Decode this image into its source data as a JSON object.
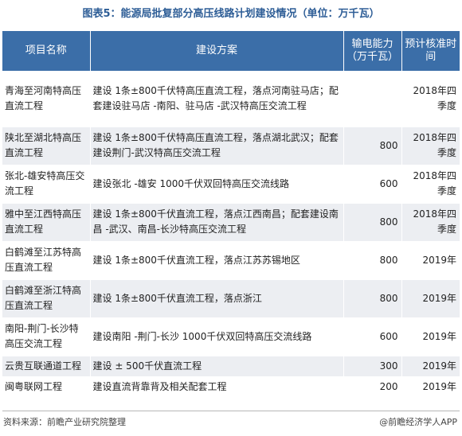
{
  "title": "图表5：能源局批复部分高压线路计划建设情况（单位：万千瓦）",
  "headers": [
    "项目名称",
    "建设方案",
    "输电能力（万千瓦）",
    "预计核准时间"
  ],
  "rows": [
    {
      "name": "青海至河南特高压直流工程",
      "plan": "建设 1条±800千伏特高压直流工程，落点河南驻马店；配套建设驻马店 -南阳、驻马店 -武汉特高压交流工程",
      "capacity": "",
      "time": "2018年四季度"
    },
    {
      "name": "陕北至湖北特高压直流工程",
      "plan": "建设 1条±800千伏特高压直流工程，落点湖北武汉；配套建设荆门-武汉特高压交流工程",
      "capacity": "800",
      "time": "2018年四季度"
    },
    {
      "name": "张北-雄安特高压交流工程",
      "plan": "建设张北 -雄安 1000千伏双回特高压交流线路",
      "capacity": "600",
      "time": "2018年四季度"
    },
    {
      "name": "雅中至江西特高压直流工程",
      "plan": "建设 1条±800千伏直流工程，落点江西南昌；配套建设南昌 -武汉、南昌-长沙特高压交流工程",
      "capacity": "800",
      "time": "2018年四季度"
    },
    {
      "name": "白鹤滩至江苏特高压直流工程",
      "plan": "建设 1条±800千伏直流工程，落点江苏苏锡地区",
      "capacity": "800",
      "time": "2019年"
    },
    {
      "name": "白鹤滩至浙江特高压直流工程",
      "plan": "建设 1条±800千伏直流工程，落点浙江",
      "capacity": "800",
      "time": "2019年"
    },
    {
      "name": "南阳-荆门-长沙特高压交流工程",
      "plan": "建设南阳 -荆门-长沙 1000千伏双回特高压交流线路",
      "capacity": "600",
      "time": "2019年"
    },
    {
      "name": "云贵互联通道工程",
      "plan": "建设 ± 500千伏直流工程",
      "capacity": "300",
      "time": "2019年"
    },
    {
      "name": "闽粤联网工程",
      "plan": "建设直流背靠背及相关配套工程",
      "capacity": "200",
      "time": "2019年"
    }
  ],
  "footer": {
    "source": "资料来源：前瞻产业研究院整理",
    "brand": "@前瞻经济学人APP"
  }
}
